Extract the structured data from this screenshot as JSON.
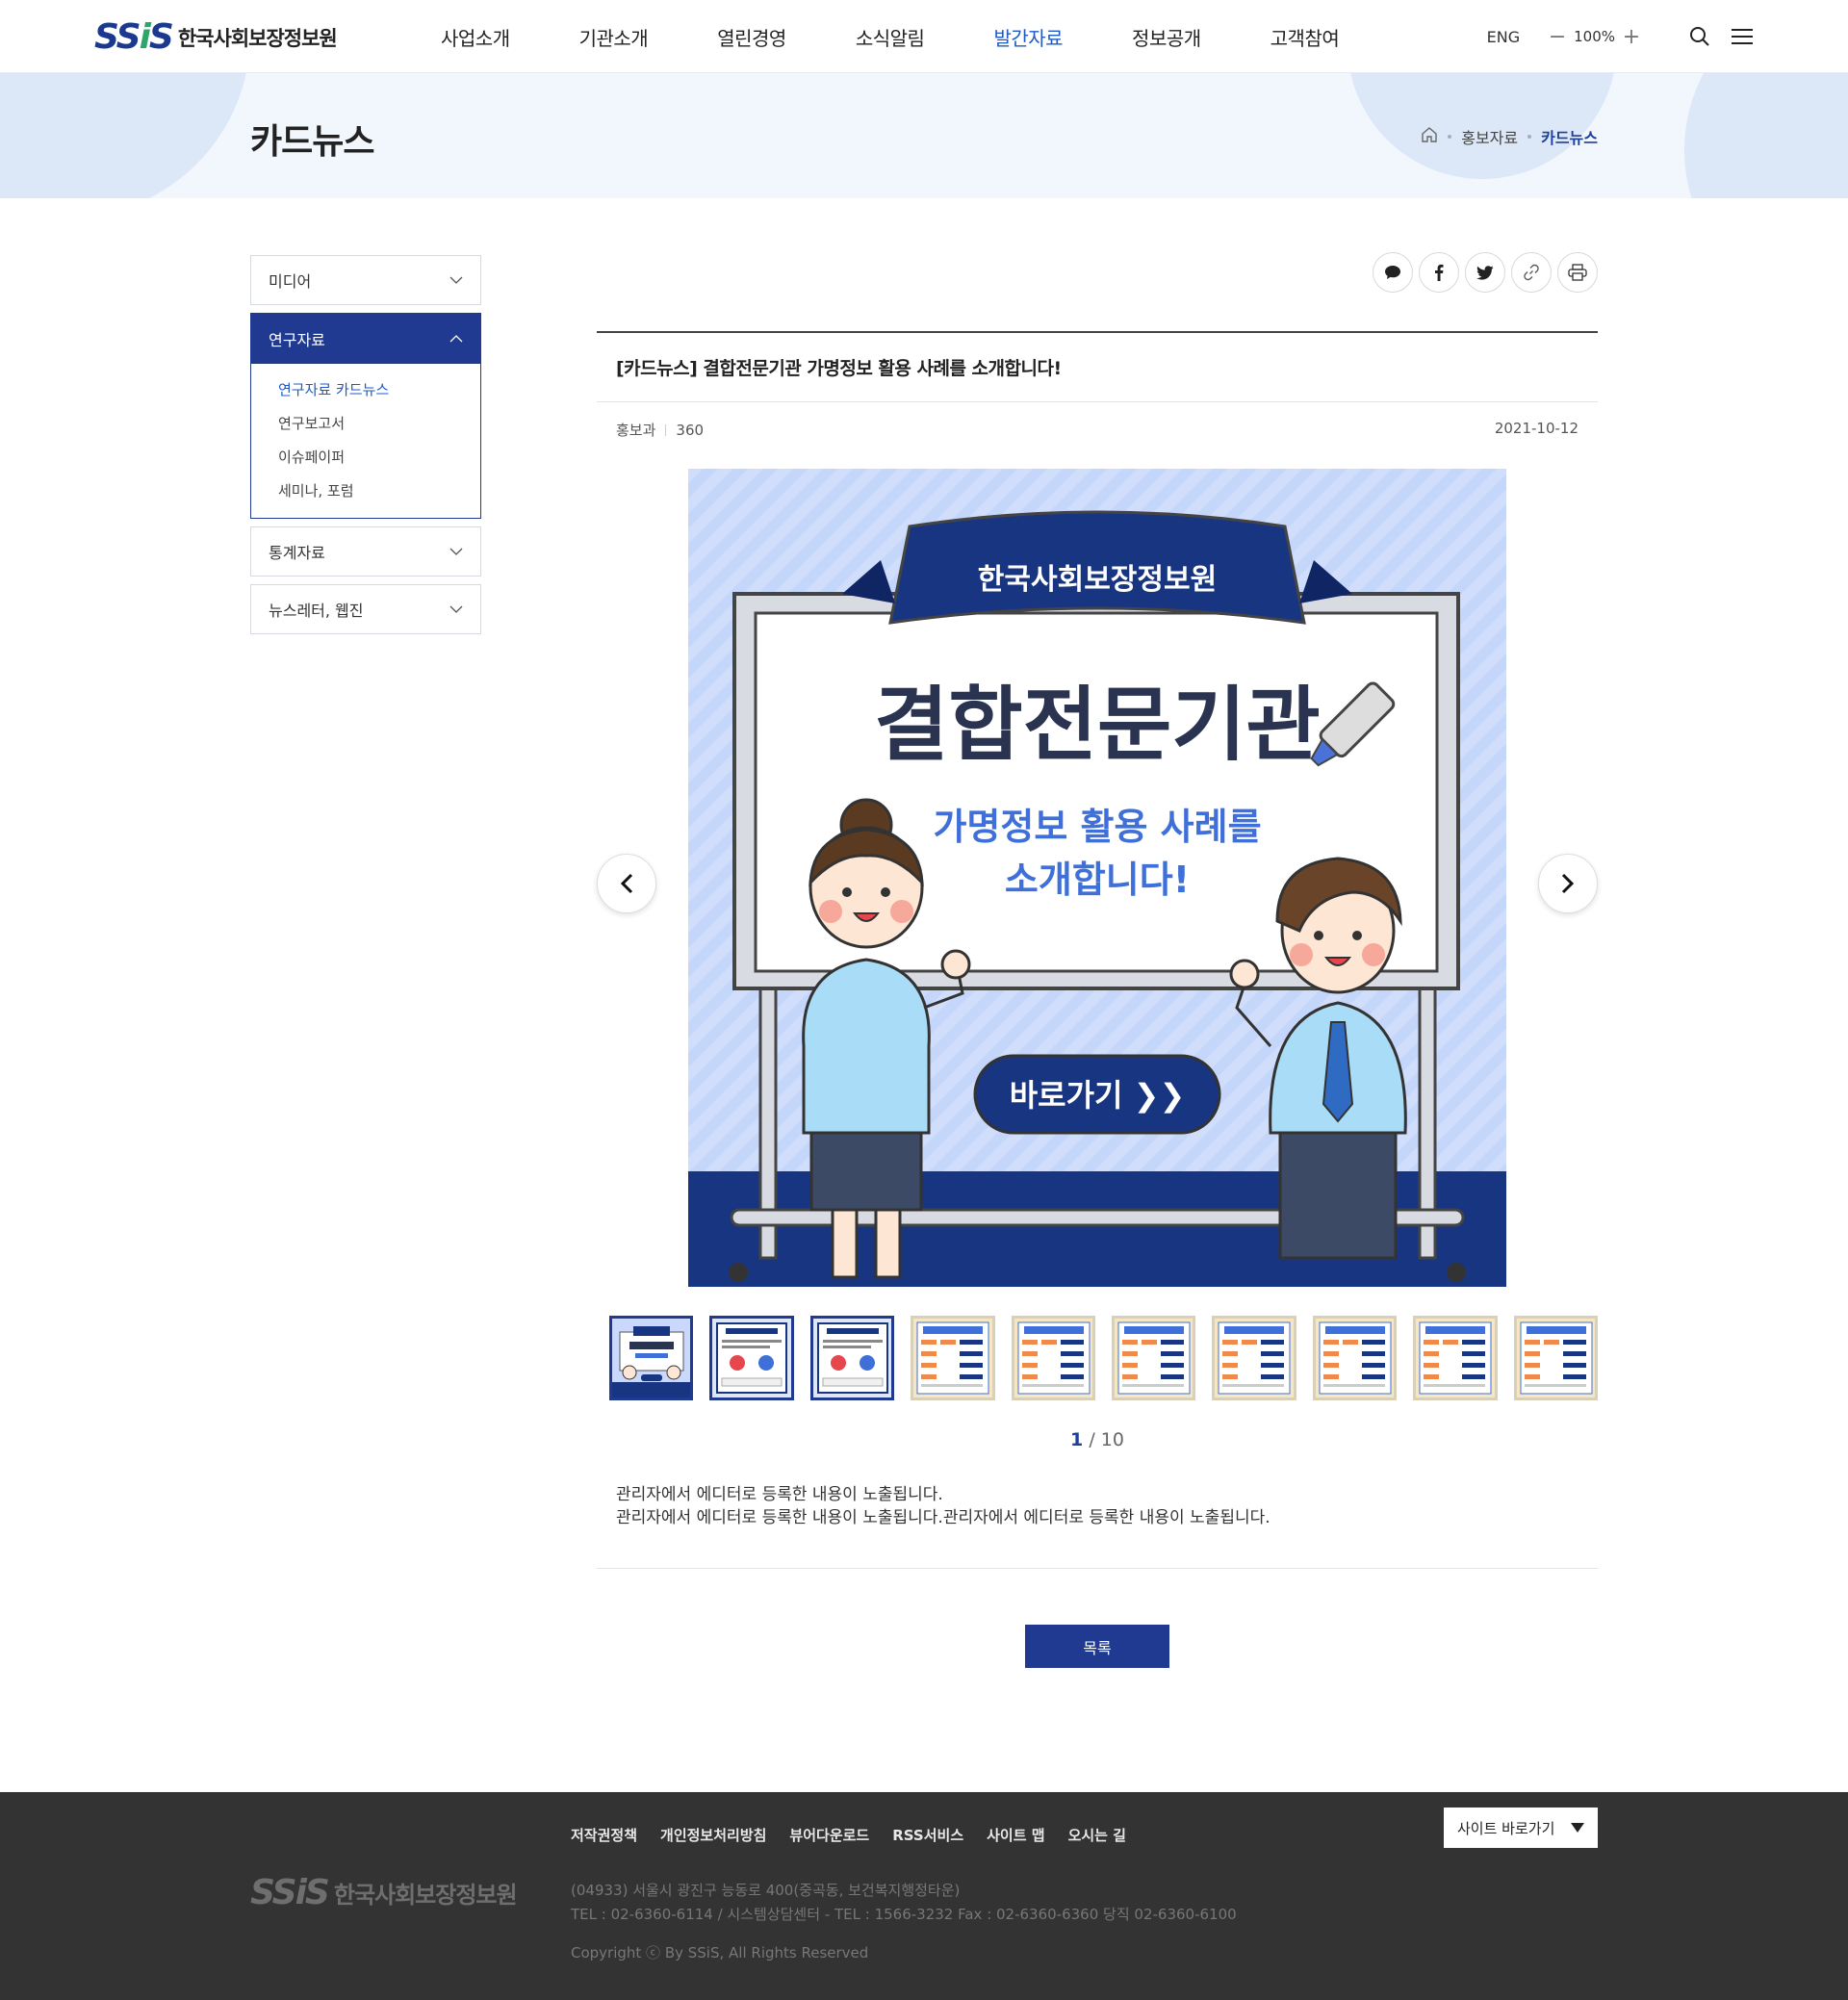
{
  "header": {
    "logo_mark": "SSiS",
    "logo_text": "한국사회보장정보원",
    "nav": [
      "사업소개",
      "기관소개",
      "열린경영",
      "소식알림",
      "발간자료",
      "정보공개",
      "고객참여"
    ],
    "lang": "ENG",
    "zoom_minus": "−",
    "zoom_value": "100%",
    "zoom_plus": "+"
  },
  "visual": {
    "title": "카드뉴스",
    "breadcrumb": [
      "홍보자료",
      "카드뉴스"
    ]
  },
  "lnb": {
    "item1": "미디어",
    "open_title": "연구자료",
    "sub": [
      "연구자료 카드뉴스",
      "연구보고서",
      "이슈페이퍼",
      "세미나, 포럼"
    ],
    "item3": "통계자료",
    "item4": "뉴스레터, 웹진"
  },
  "article": {
    "title": "[카드뉴스] 결합전문기관 가명정보 활용 사례를 소개합니다!",
    "dept": "홍보과",
    "views": "360",
    "date": "2021-10-12",
    "card": {
      "ribbon": "한국사회보장정보원",
      "headline": "결합전문기관",
      "sub1": "가명정보 활용 사례를",
      "sub2": "소개합니다!",
      "button": "바로가기 ❯❯"
    },
    "paging_current": "1",
    "paging_total": "/ 10",
    "body1": "관리자에서 에디터로 등록한 내용이 노출됩니다.",
    "body2": "관리자에서 에디터로 등록한 내용이 노출됩니다.관리자에서 에디터로 등록한 내용이 노출됩니다.",
    "list_button": "목록"
  },
  "footer": {
    "links": [
      "저작권정책",
      "개인정보처리방침",
      "뷰어다운로드",
      "RSS서비스",
      "사이트 맵",
      "오시는 길"
    ],
    "site_select": "사이트 바로가기",
    "logo_mark": "SSiS",
    "logo_text": "한국사회보장정보원",
    "addr1": "(04933) 서울시 광진구 능동로 400(중곡동, 보건복지행정타운)",
    "addr2": "TEL :  02-6360-6114 / 시스템상담센터 - TEL : 1566-3232  Fax :  02-6360-6360  당직 02-6360-6100",
    "copyright": "Copyright ⓒ By SSiS, All Rights Reserved"
  },
  "colors": {
    "primary": "#203a91",
    "accent": "#1e5bc6",
    "footer_bg": "#333333"
  }
}
